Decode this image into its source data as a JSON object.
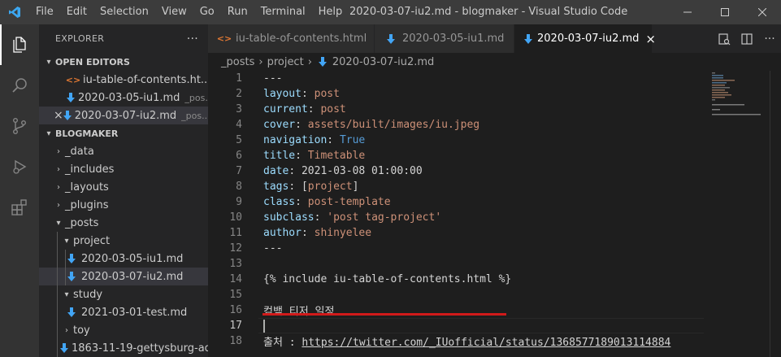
{
  "window": {
    "title": "2020-03-07-iu2.md - blogmaker - Visual Studio Code",
    "menu": [
      "File",
      "Edit",
      "Selection",
      "View",
      "Go",
      "Run",
      "Terminal",
      "Help"
    ]
  },
  "sidebar": {
    "header": "EXPLORER",
    "more": "···",
    "open_editors": {
      "title": "OPEN EDITORS",
      "items": [
        {
          "name": "iu-table-of-contents.ht...",
          "desc": "",
          "icon": "html-icon"
        },
        {
          "name": "2020-03-05-iu1.md",
          "desc": "_pos...",
          "icon": "markdown-icon"
        },
        {
          "name": "2020-03-07-iu2.md",
          "desc": "_pos...",
          "icon": "markdown-icon"
        }
      ]
    },
    "project": {
      "title": "BLOGMAKER",
      "tree": [
        {
          "label": "_data"
        },
        {
          "label": "_includes"
        },
        {
          "label": "_layouts"
        },
        {
          "label": "_plugins"
        },
        {
          "label": "_posts"
        },
        {
          "label": "project"
        },
        {
          "label": "2020-03-05-iu1.md"
        },
        {
          "label": "2020-03-07-iu2.md"
        },
        {
          "label": "study"
        },
        {
          "label": "2021-03-01-test.md"
        },
        {
          "label": "toy"
        },
        {
          "label": "1863-11-19-gettysburg-ad..."
        }
      ]
    }
  },
  "tabs": [
    {
      "label": "iu-table-of-contents.html"
    },
    {
      "label": "2020-03-05-iu1.md"
    },
    {
      "label": "2020-03-07-iu2.md"
    }
  ],
  "breadcrumbs": [
    "_posts",
    "project",
    "2020-03-07-iu2.md"
  ],
  "code": {
    "line_numbers": [
      "1",
      "2",
      "3",
      "4",
      "5",
      "6",
      "7",
      "8",
      "9",
      "10",
      "11",
      "12",
      "13",
      "14",
      "15",
      "16",
      "17",
      "18"
    ],
    "l1": "---",
    "l2_key": "layout",
    "l2_val": "post",
    "l3_key": "current",
    "l3_val": "post",
    "l4_key": "cover",
    "l4_val": "assets/built/images/iu.jpeg",
    "l5_key": "navigation",
    "l5_val": "True",
    "l6_key": "title",
    "l6_val": "Timetable",
    "l7_key": "date",
    "l7_val": "2021-03-08 01:00:00",
    "l8_key": "tags",
    "l8_open": "[",
    "l8_val": "project",
    "l8_close": "]",
    "l9_key": "class",
    "l9_val": "post-template",
    "l10_key": "subclass",
    "l10_val": "'post tag-project'",
    "l11_key": "author",
    "l11_val": "shinyelee",
    "l12": "---",
    "l14": "{% include iu-table-of-contents.html %}",
    "l16": "컴백 티저 일정",
    "l18_label": "출처 : ",
    "l18_link": "https://twitter.com/_IUofficial/status/1368577189013114884"
  },
  "colors": {
    "accent_red": "#d11a1a",
    "key": "#9cdcfe",
    "string": "#ce9178",
    "number": "#b5cea8",
    "keyword": "#569cd6"
  }
}
